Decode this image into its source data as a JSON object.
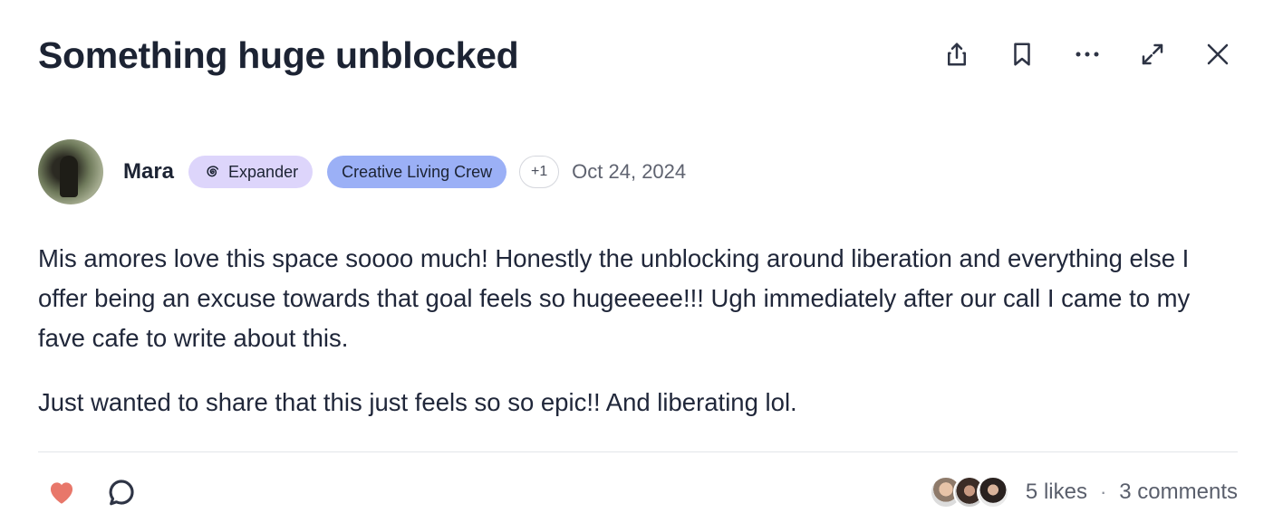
{
  "post": {
    "title": "Something huge unblocked",
    "toolbar": {
      "share_icon": "share-icon",
      "bookmark_icon": "bookmark-icon",
      "more_icon": "more-horizontal-icon",
      "expand_icon": "expand-icon",
      "close_icon": "close-icon"
    },
    "author": {
      "name": "Mara",
      "badge_level": "Expander",
      "badge_level_icon": "spiral-icon",
      "badge_group": "Creative Living Crew",
      "more_badges": "+1",
      "date": "Oct 24, 2024"
    },
    "body": {
      "paragraph_1": "Mis amores love this space soooo much! Honestly the unblocking around liberation and everything else I offer being an excuse towards that goal feels so hugeeeee!!! Ugh immediately after our call I came to my fave cafe to write about this.",
      "paragraph_2": "Just wanted to share that this just feels so so epic!! And liberating lol."
    },
    "footer": {
      "like_icon": "heart-icon",
      "comment_icon": "comment-icon",
      "likes": "5 likes",
      "separator": "·",
      "comments": "3 comments"
    }
  },
  "colors": {
    "badge_level_bg": "#ddd5fb",
    "badge_group_bg": "#9bb0f6",
    "heart": "#e8776a",
    "text": "#1c2333",
    "muted": "#5f6370"
  }
}
